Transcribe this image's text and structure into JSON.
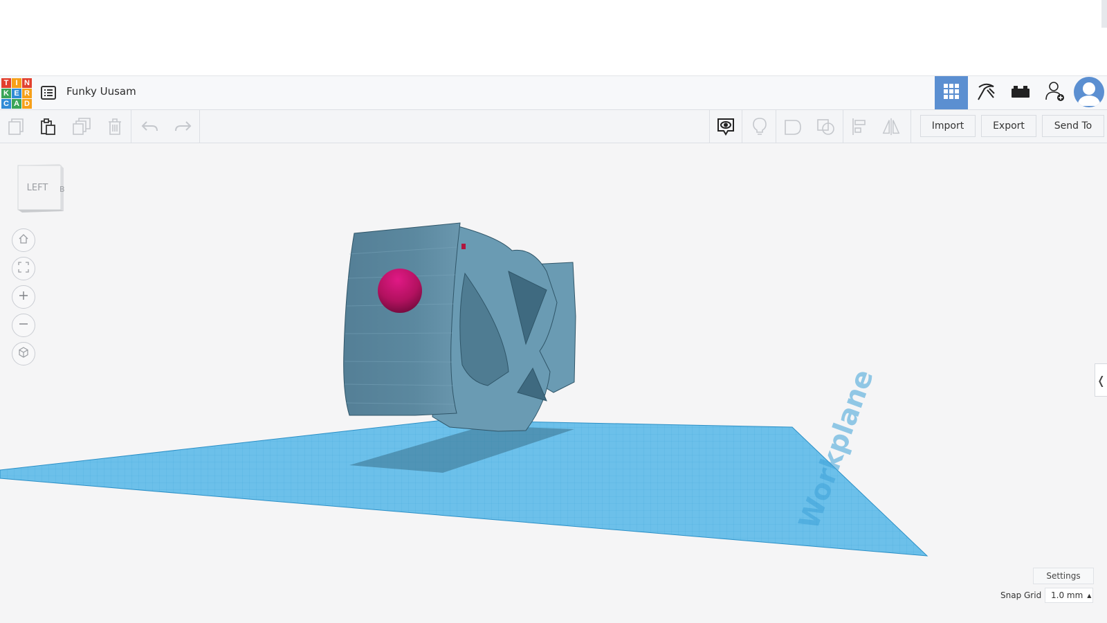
{
  "app": {
    "logo_letters": [
      "T",
      "I",
      "N",
      "K",
      "E",
      "R",
      "C",
      "A",
      "D"
    ],
    "document_title": "Funky Uusam"
  },
  "header": {
    "modes": [
      {
        "icon": "grid-3d-icon",
        "active": true
      },
      {
        "icon": "pickaxe-icon",
        "active": false
      },
      {
        "icon": "bricks-icon",
        "active": false
      }
    ],
    "icons": [
      "projects-list-icon",
      "add-user-icon",
      "user-avatar-icon"
    ]
  },
  "toolbar": {
    "left_icons": [
      "copy-icon",
      "paste-icon",
      "duplicate-icon",
      "delete-icon",
      "undo-icon",
      "redo-icon"
    ],
    "right_icons": [
      "notes-visibility-icon",
      "lightbulb-icon",
      "group-icon",
      "ungroup-icon",
      "align-icon",
      "mirror-icon"
    ],
    "import_label": "Import",
    "export_label": "Export",
    "send_to_label": "Send To"
  },
  "viewport": {
    "view_cube_face": "LEFT",
    "view_cube_side": "BACK",
    "nav_icons": [
      "home-view-icon",
      "fit-view-icon",
      "zoom-in-icon",
      "zoom-out-icon",
      "perspective-icon"
    ],
    "workplane_watermark": "Workplane",
    "settings_label": "Settings",
    "snap_grid_label": "Snap Grid",
    "snap_grid_value": "1.0 mm",
    "colors": {
      "model": "#5f8ea6",
      "sphere": "#c2126e",
      "workplane": "#4fb2e3",
      "accent": "#5b8fd1"
    }
  }
}
